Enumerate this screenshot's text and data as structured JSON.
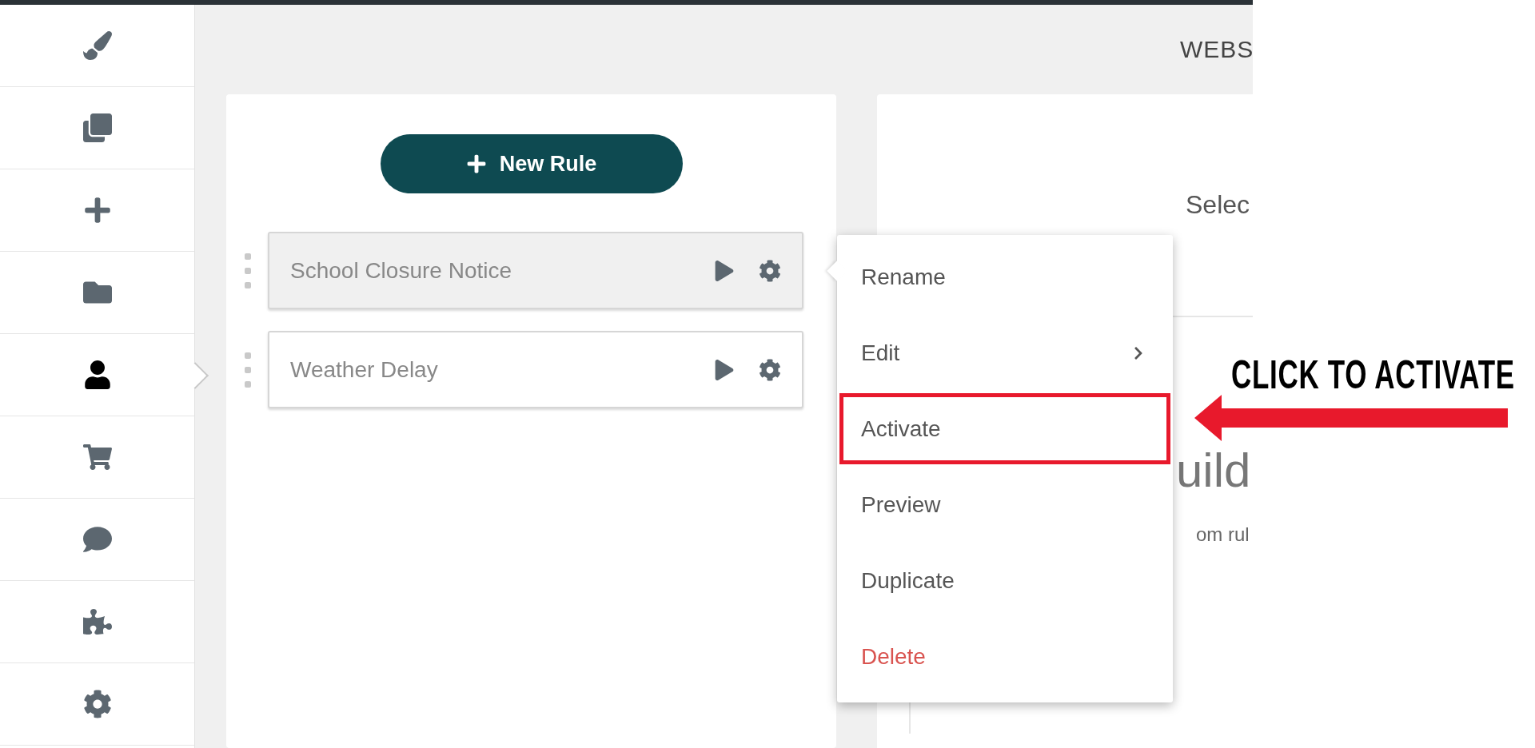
{
  "sidebar": {
    "items": [
      {
        "kind": "brush",
        "selected": false
      },
      {
        "kind": "copy",
        "selected": false
      },
      {
        "kind": "plus",
        "selected": false
      },
      {
        "kind": "folder",
        "selected": false
      },
      {
        "kind": "user",
        "selected": true
      },
      {
        "kind": "cart",
        "selected": false
      },
      {
        "kind": "comment",
        "selected": false
      },
      {
        "kind": "puzzle",
        "selected": false
      },
      {
        "kind": "gear",
        "selected": false
      }
    ]
  },
  "header": {
    "title": "WEBS"
  },
  "rules_panel": {
    "new_button": "New Rule",
    "rules": [
      {
        "name": "School Closure Notice",
        "selected": true
      },
      {
        "name": "Weather Delay",
        "selected": false
      }
    ]
  },
  "detail_panel": {
    "prompt": "Selec",
    "heading": "uild",
    "description": "om rul"
  },
  "context_menu": {
    "items": [
      {
        "label": "Rename",
        "kind": "plain",
        "highlighted": false
      },
      {
        "label": "Edit",
        "kind": "submenu",
        "highlighted": false
      },
      {
        "label": "Activate",
        "kind": "plain",
        "highlighted": true
      },
      {
        "label": "Preview",
        "kind": "plain",
        "highlighted": false
      },
      {
        "label": "Duplicate",
        "kind": "plain",
        "highlighted": false
      },
      {
        "label": "Delete",
        "kind": "danger",
        "highlighted": false
      }
    ]
  },
  "annotation": {
    "text": "CLICK TO ACTIVATE"
  }
}
